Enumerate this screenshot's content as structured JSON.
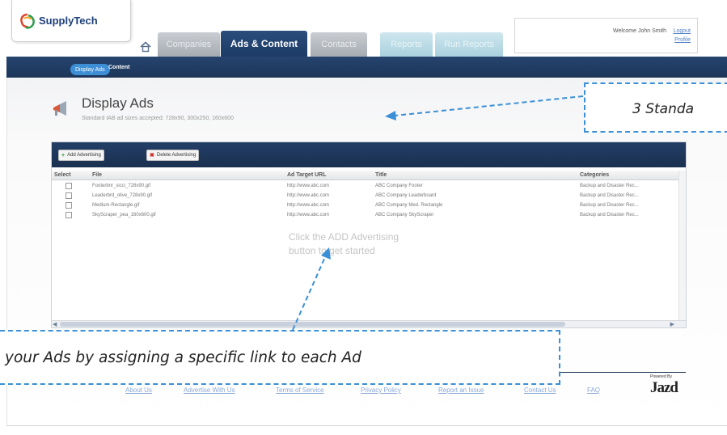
{
  "header": {
    "logo_text": "SupplyTech",
    "welcome": "Welcome John Smith",
    "logout": "Logout",
    "profile": "Profile"
  },
  "nav": {
    "tabs": [
      {
        "label": "Companies",
        "active": false
      },
      {
        "label": "Ads & Content",
        "active": true
      },
      {
        "label": "Contacts",
        "active": false
      },
      {
        "label": "Reports",
        "active": false
      },
      {
        "label": "Run Reports",
        "active": false
      }
    ],
    "subnav": [
      "Display Ads",
      "Content"
    ]
  },
  "page": {
    "title": "Display Ads",
    "subtitle": "Standard IAB ad sizes accepted: 728x90, 300x250, 160x600"
  },
  "toolbar": {
    "add_label": "Add Advertising",
    "delete_label": "Delete Advertising"
  },
  "grid": {
    "columns": [
      "Select",
      "File",
      "Ad Target URL",
      "Title",
      "Categories"
    ],
    "rows": [
      {
        "file": "Footerbnr_sicci_728x90.gif",
        "url": "http://www.abc.com",
        "title": "ABC Company Footer",
        "category": "Backup and Disaster Rec..."
      },
      {
        "file": "Leaderbrd_olive_728x90.gif",
        "url": "http://www.abc.com",
        "title": "ABC Company Leaderboard",
        "category": "Backup and Disaster Rec..."
      },
      {
        "file": "Medium-Rectangle.gif",
        "url": "http://www.abc.com",
        "title": "ABC Company Med. Rectangle",
        "category": "Backup and Disaster Rec..."
      },
      {
        "file": "SkyScraper_pea_160x600.gif",
        "url": "http://www.abc.com",
        "title": "ABC Company SkyScraper",
        "category": "Backup and Disaster Rec..."
      }
    ],
    "empty_message": "Click the ADD Advertising button to get started"
  },
  "footer": {
    "links": [
      "About Us",
      "Advertise With Us",
      "Terms of Service",
      "Privacy Policy",
      "Report an Issue",
      "Contact Us",
      "FAQ"
    ],
    "powered_by": "Powered By",
    "brand": "Jazd"
  },
  "callouts": {
    "top": "3 Standa",
    "bottom": "your Ads by assigning a specific link to each Ad"
  },
  "colors": {
    "navy": "#1c3659",
    "accent_blue": "#3d8ed5",
    "callout_border": "#3a8fd6"
  }
}
